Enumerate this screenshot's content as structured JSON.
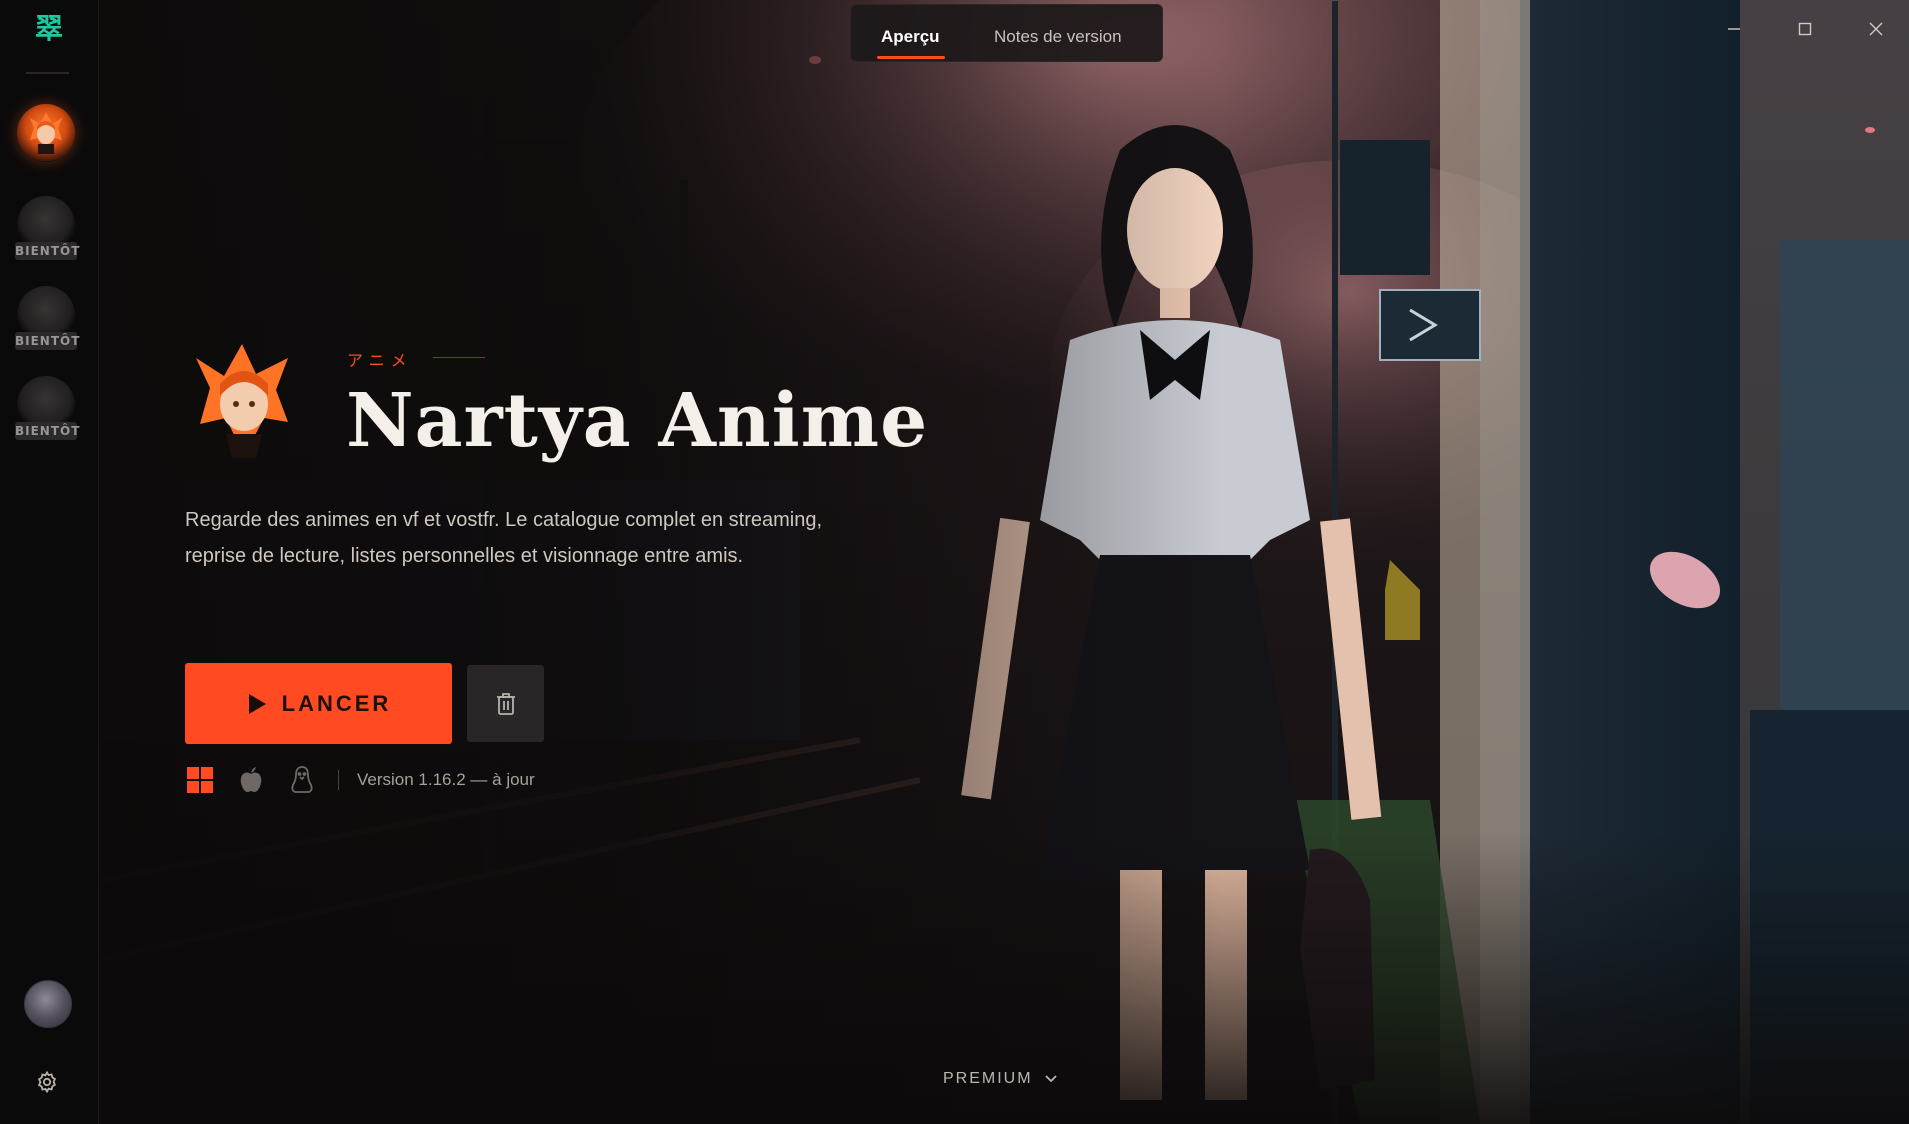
{
  "app": {
    "logo_glyph": "翠",
    "accent": "#ff4a22",
    "logo_color": "#1fc8a0"
  },
  "sidebar": {
    "games": [
      {
        "name": "Nartya Anime",
        "state": "active"
      },
      {
        "state": "soon",
        "badge": "BIENTÔT"
      },
      {
        "state": "soon",
        "badge": "BIENTÔT"
      },
      {
        "state": "soon",
        "badge": "BIENTÔT"
      }
    ],
    "bottom_icons": [
      "user-avatar",
      "gear-icon"
    ]
  },
  "tabs": [
    {
      "label": "Aperçu",
      "active": true
    },
    {
      "label": "Notes de version",
      "active": false
    }
  ],
  "window_controls": [
    "minimize-icon",
    "maximize-icon",
    "close-icon"
  ],
  "game": {
    "kana": "アニメ",
    "title": "Nartya Anime",
    "description": "Regarde des animes en vf et vostfr. Le catalogue complet en streaming, reprise de lecture, listes personnelles et visionnage entre amis.",
    "launch_label": "LANCER",
    "platform_icons": [
      "windows-icon",
      "apple-icon",
      "linux-icon"
    ],
    "version_text": "Version 1.16.2 — à jour"
  },
  "footer": {
    "premium_label": "PREMIUM"
  }
}
